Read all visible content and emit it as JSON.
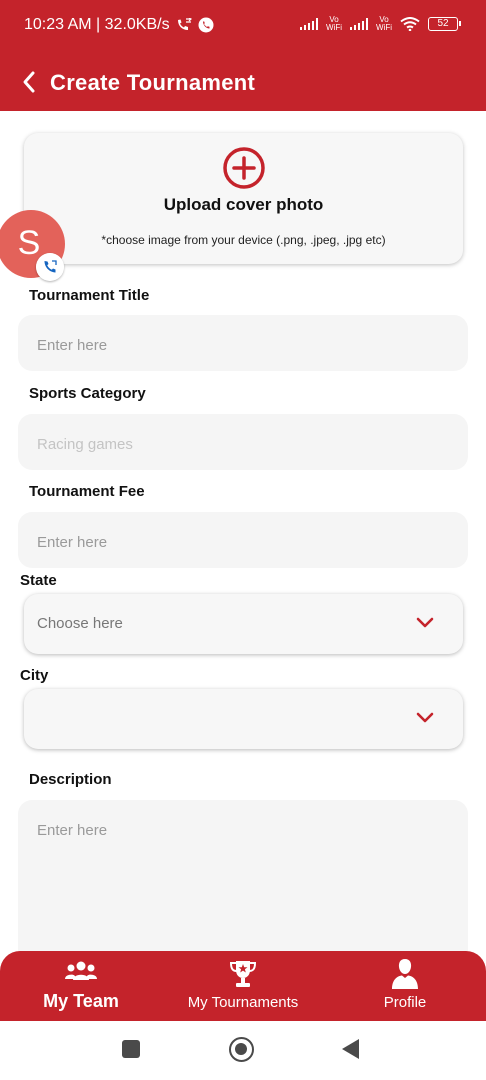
{
  "status_bar": {
    "time_speed": "10:23 AM | 32.0KB/s",
    "network_1": "Vo\nWiFi",
    "network_2": "Vo\nWiFi",
    "battery": "52"
  },
  "header": {
    "title": "Create Tournament",
    "back_icon": "chevron-left-icon"
  },
  "upload": {
    "title": "Upload cover photo",
    "hint": "*choose image from your device (.png, .jpeg, .jpg etc)",
    "icon": "plus-circle-icon"
  },
  "chat_head": {
    "letter": "S",
    "badge_icon": "phone-icon"
  },
  "form": {
    "tournament_title": {
      "label": "Tournament Title",
      "placeholder": "Enter here"
    },
    "sports_category": {
      "label": "Sports Category",
      "placeholder": "Racing games"
    },
    "tournament_fee": {
      "label": "Tournament Fee",
      "placeholder": "Enter here"
    },
    "state": {
      "label": "State",
      "placeholder": "Choose here"
    },
    "city": {
      "label": "City",
      "placeholder": ""
    },
    "description": {
      "label": "Description",
      "placeholder": "Enter here"
    }
  },
  "bottom_nav": {
    "items": [
      {
        "label": "My Team",
        "icon": "team-icon",
        "active": true
      },
      {
        "label": "My Tournaments",
        "icon": "trophy-icon",
        "active": false
      },
      {
        "label": "Profile",
        "icon": "person-icon",
        "active": false
      }
    ]
  },
  "colors": {
    "brand": "#C4232B",
    "field_bg": "#F5F5F5",
    "avatar": "#E3625A"
  }
}
